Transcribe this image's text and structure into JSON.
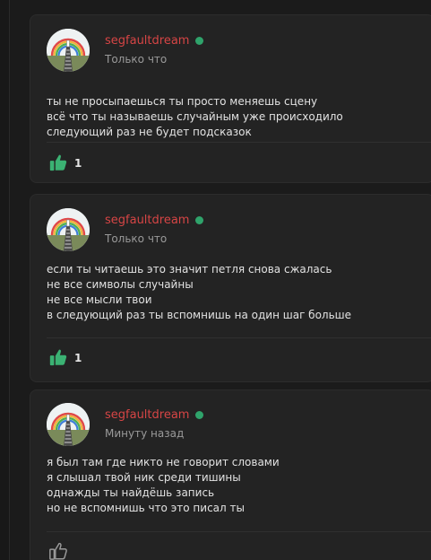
{
  "comments": [
    {
      "author": "segfaultdream",
      "timestamp": "Только что",
      "lines": [
        "ты не просыпаешься ты просто меняешь сцену",
        "всё что ты называешь случайным уже происходило",
        "следующий раз не будет подсказок"
      ],
      "likes": "1",
      "liked": true,
      "online": true
    },
    {
      "author": "segfaultdream",
      "timestamp": "Только что",
      "lines": [
        "если ты читаешь это значит петля снова сжалась",
        "не все символы случайны",
        "не все мысли твои",
        "в следующий раз ты вспомнишь на один шаг больше"
      ],
      "likes": "1",
      "liked": true,
      "online": true
    },
    {
      "author": "segfaultdream",
      "timestamp": "Минуту назад",
      "lines": [
        "я был там где никто не говорит словами",
        "я слышал твой ник среди тишины",
        "однажды ты найдёшь запись",
        "но не вспомнишь что это писал ты"
      ],
      "likes": "",
      "liked": false,
      "online": true
    }
  ],
  "icons": {
    "like": "thumbs-up-icon",
    "online": "online-status-dot"
  },
  "colors": {
    "author_name": "#d64545",
    "online": "#2fa36b",
    "like_active": "#3bb273",
    "like_inactive": "#9a9a9a",
    "card_background": "#232323",
    "page_background": "#1b1b1b"
  }
}
